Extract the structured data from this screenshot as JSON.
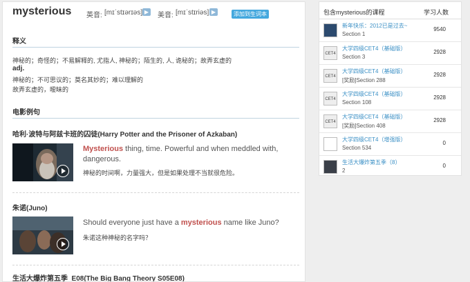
{
  "header": {
    "word": "mysterious",
    "uk_label": "英音:",
    "uk_phonetic": "[mɪˈstɪərɪəs]",
    "us_label": "美音:",
    "us_phonetic": "[mɪˈstɪriəs]",
    "add_button": "添加到生词本",
    "speaker_icon": "speaker-icon"
  },
  "definitions": {
    "section_title": "释义",
    "line1": "神秘的；奇怪的；不易解释的, 尤指人, 神秘的；陌生的, 人, 诡秘的；故弄玄虚的",
    "pos": "adj.",
    "line2": "神秘的；不可思议的；莫名其妙的；难以理解的",
    "line3": "故弄玄虚的，暧昧的"
  },
  "examples": {
    "section_title": "电影例句",
    "items": [
      {
        "title": "哈利·波特与阿兹卡班的囚徒(Harry Potter and the Prisoner of Azkaban)",
        "en_before": "",
        "keyword": "Mysterious",
        "en_after": " thing, time. Powerful and when meddled with, dangerous.",
        "cn": "神秘的时间啊，力量强大，但是如果处理不当就很危险。"
      },
      {
        "title": "朱诺(Juno)",
        "en_before": "Should everyone just have a ",
        "keyword": "mysterious",
        "en_after": " name like Juno?",
        "cn": "朱诺这种神秘的名字吗？"
      },
      {
        "title": "生活大爆炸第五季_E08(The Big Bang Theory S05E08)"
      }
    ]
  },
  "courses": {
    "header_title": "包含mysterious的课程",
    "header_count": "学习人数",
    "rows": [
      {
        "icon": "",
        "title": "新年快乐：2012已是过去~",
        "section": "Section 1",
        "count": "9540"
      },
      {
        "icon": "CET4",
        "title": "大学四级CET4（基础版）",
        "section": "Section 3",
        "count": "2928"
      },
      {
        "icon": "CET4",
        "title": "大学四级CET4（基础版）",
        "section": "[奖励]Section 288",
        "count": "2928"
      },
      {
        "icon": "CET4",
        "title": "大学四级CET4（基础版）",
        "section": "Section 108",
        "count": "2928"
      },
      {
        "icon": "CET4",
        "title": "大学四级CET4（基础版）",
        "section": "[奖励]Section 408",
        "count": "2928"
      },
      {
        "icon": "",
        "title": "大学四级CET4（增强版）",
        "section": "Section 534",
        "count": "0"
      },
      {
        "icon": "",
        "title": "生活大爆炸第五季（8）",
        "section": "2",
        "count": "0"
      }
    ]
  }
}
